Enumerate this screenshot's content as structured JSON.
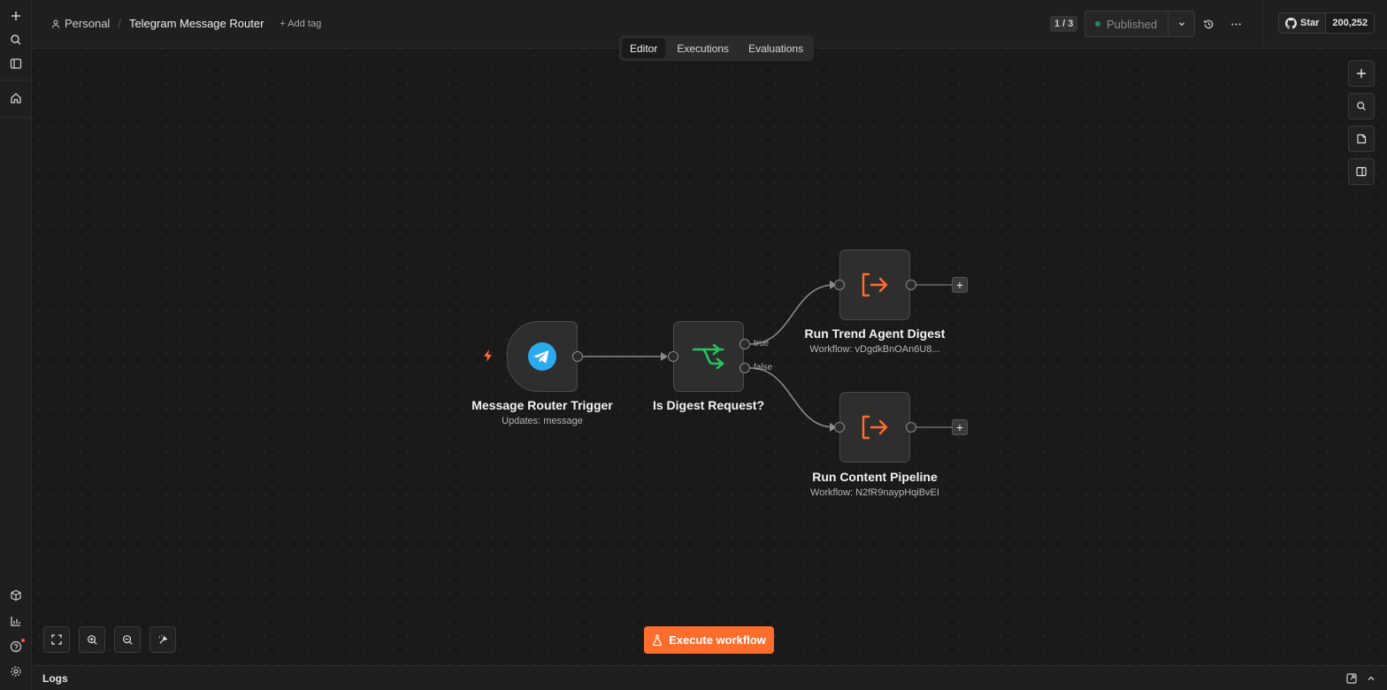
{
  "header": {
    "project": "Personal",
    "workflow_title": "Telegram Message Router",
    "add_tag": "+ Add tag",
    "version": "1 / 3",
    "publish_status": "Published",
    "github_star_label": "Star",
    "github_star_count": "200,252"
  },
  "tabs": [
    {
      "label": "Editor",
      "active": true
    },
    {
      "label": "Executions",
      "active": false
    },
    {
      "label": "Evaluations",
      "active": false
    }
  ],
  "nodes": {
    "trigger": {
      "title": "Message Router Trigger",
      "subtitle": "Updates: message",
      "icon": "telegram-icon"
    },
    "if": {
      "title": "Is Digest Request?",
      "icon": "if-branch-icon",
      "true_label": "true",
      "false_label": "false"
    },
    "trend": {
      "title": "Run Trend Agent Digest",
      "subtitle": "Workflow: vDgdkBnOAn6U8...",
      "icon": "execute-workflow-icon"
    },
    "content": {
      "title": "Run Content Pipeline",
      "subtitle": "Workflow: N2fR9naypHqiBvEI",
      "icon": "execute-workflow-icon"
    }
  },
  "execute_button": "Execute workflow",
  "logs": {
    "title": "Logs"
  },
  "colors": {
    "accent": "#ff6d2d",
    "if_green": "#22c55e",
    "telegram_blue": "#2aabee",
    "published_dot": "#1f8a6b"
  }
}
